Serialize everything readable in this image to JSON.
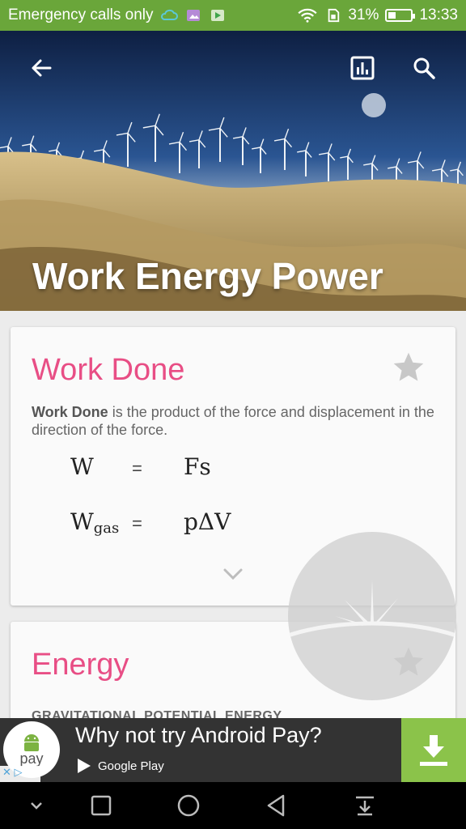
{
  "status_bar": {
    "carrier_text": "Emergency calls only",
    "battery_percent": "31%",
    "battery_level": 0.31,
    "time": "13:33",
    "icons": [
      "cloud-icon",
      "image-icon",
      "play-store-icon",
      "wifi-icon",
      "sim-icon",
      "battery-icon"
    ]
  },
  "toolbar": {
    "back_icon": "arrow-back-icon",
    "stats_icon": "bar-chart-icon",
    "search_icon": "search-icon"
  },
  "hero": {
    "title": "Work Energy Power"
  },
  "cards": [
    {
      "title": "Work Done",
      "description_bold": "Work Done",
      "description_rest": " is the product of the force and displacement in the direction of the force.",
      "formulas": [
        {
          "lhs": "W",
          "lhs_sub": "",
          "eq": "=",
          "rhs": "Fs"
        },
        {
          "lhs": "W",
          "lhs_sub": "gas",
          "eq": "=",
          "rhs": "pΔV"
        }
      ],
      "expand_icon": "chevron-down-icon",
      "favorite_icon": "star-icon"
    },
    {
      "title": "Energy",
      "subheading": "GRAVITATIONAL POTENTIAL ENERGY",
      "favorite_icon": "star-icon"
    }
  ],
  "ad": {
    "logo_text": "pay",
    "headline": "Why not try Android Pay?",
    "store_label": "Google Play",
    "download_icon": "download-icon",
    "accent": "#8bc34a"
  },
  "nav_bar": {
    "icons": [
      "chevron-down-icon",
      "recents-square-icon",
      "home-circle-icon",
      "back-triangle-icon",
      "notification-pull-icon"
    ]
  },
  "colors": {
    "status_bar": "#6aa63a",
    "card_title": "#e84e85",
    "star": "#c8c8c8"
  }
}
